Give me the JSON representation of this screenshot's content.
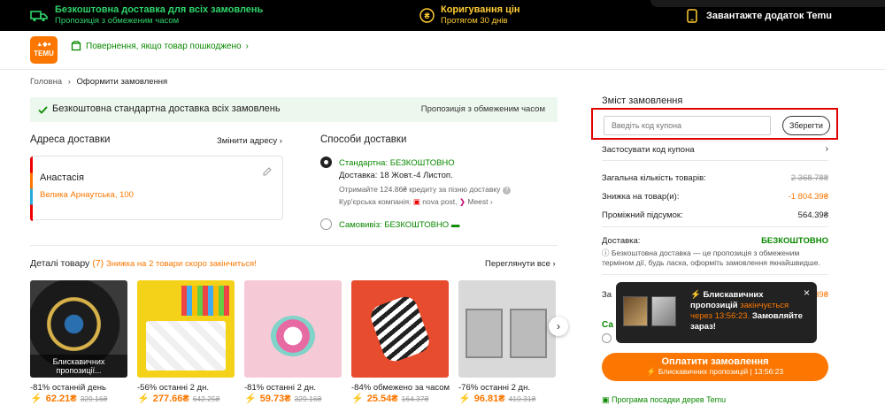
{
  "topbar": {
    "free_shipping_title": "Безкоштовна доставка для всіх замовлень",
    "free_shipping_sub": "Пропозиція з обмеженим часом",
    "price_adjust_title": "Коригування цін",
    "price_adjust_sub": "Протягом 30 днів",
    "app_download": "Завантажте додаток Temu"
  },
  "header": {
    "logo_text": "TEMU",
    "return_note": "Повернення, якщо товар пошкоджено"
  },
  "breadcrumb": {
    "home": "Головна",
    "current": "Оформити замовлення"
  },
  "banner": {
    "label": "Безкоштовна стандартна доставка всіх замовлень",
    "right": "Пропозиція з обмеженим часом"
  },
  "address": {
    "title": "Адреса доставки",
    "change_link": "Змінити адресу",
    "name": "Анастасія",
    "street": "Велика Арнаутська, 100"
  },
  "shipping": {
    "title": "Способи доставки",
    "standard_label": "Стандартна:",
    "standard_value": "БЕЗКОШТОВНО",
    "delivery": "Доставка: 18 Жовт.-4 Листоп.",
    "credit_note": "Отримайте 124.86₴ кредиту за пізню доставку",
    "couriers_label": "Кур'єрська компанія:",
    "courier1": "nova post,",
    "courier2": "Meest",
    "pickup_label": "Самовивіз:",
    "pickup_value": "БЕЗКОШТОВНО"
  },
  "products": {
    "title": "Деталі товару",
    "count": "(7)",
    "promo": "Знижка на 2 товари скоро закінчиться!",
    "view_all": "Переглянути все",
    "overlay": "Блискавичних пропозиції...",
    "items": [
      {
        "tag": "-81% останній день",
        "price": "62.21₴",
        "old": "329.16₴"
      },
      {
        "tag": "-56% останні 2 дн.",
        "price": "277.66₴",
        "old": "642.25₴"
      },
      {
        "tag": "-81% останні 2 дн.",
        "price": "59.73₴",
        "old": "329.16₴"
      },
      {
        "tag": "-84% обмежено за часом",
        "price": "25.54₴",
        "old": "164.37₴"
      },
      {
        "tag": "-76% останні 2 дн.",
        "price": "96.81₴",
        "old": "410.31₴"
      }
    ]
  },
  "summary": {
    "title": "Зміст замовлення",
    "coupon_placeholder": "Введіть код купона",
    "coupon_save": "Зберегти",
    "apply_coupon": "Застосувати код купона",
    "total_items_label": "Загальна кількість товарів:",
    "total_items_value": "2 368.78₴",
    "discount_label": "Знижка на товар(и):",
    "discount_value": "-1 804.39₴",
    "subtotal_label": "Проміжний підсумок:",
    "subtotal_value": "564.39₴",
    "shipping_label": "Доставка:",
    "shipping_value": "БЕЗКОШТОВНО",
    "shipping_note": "Безкоштовна доставка — це пропозиція з обмеженим терміном дії, будь ласка, оформіть замовлення якнайшвидше.",
    "partial_label_1": "За",
    "partial_value_1": "39₴",
    "partial_label_2": "Са",
    "pay_button": "Оплатити замовлення",
    "pay_sub": "Блискавичних пропозицій | 13:56:23",
    "tree_program": "Програма посадки дерев Temu"
  },
  "tooltip": {
    "title": "Блискавичних пропозицій",
    "ends": "закінчується через 13:56:23.",
    "cta": "Замовляйте зараз!"
  },
  "colors": {
    "accent": "#fb7701",
    "green": "#0a8800",
    "topbar": "#000000",
    "highlight": "#e00000"
  }
}
